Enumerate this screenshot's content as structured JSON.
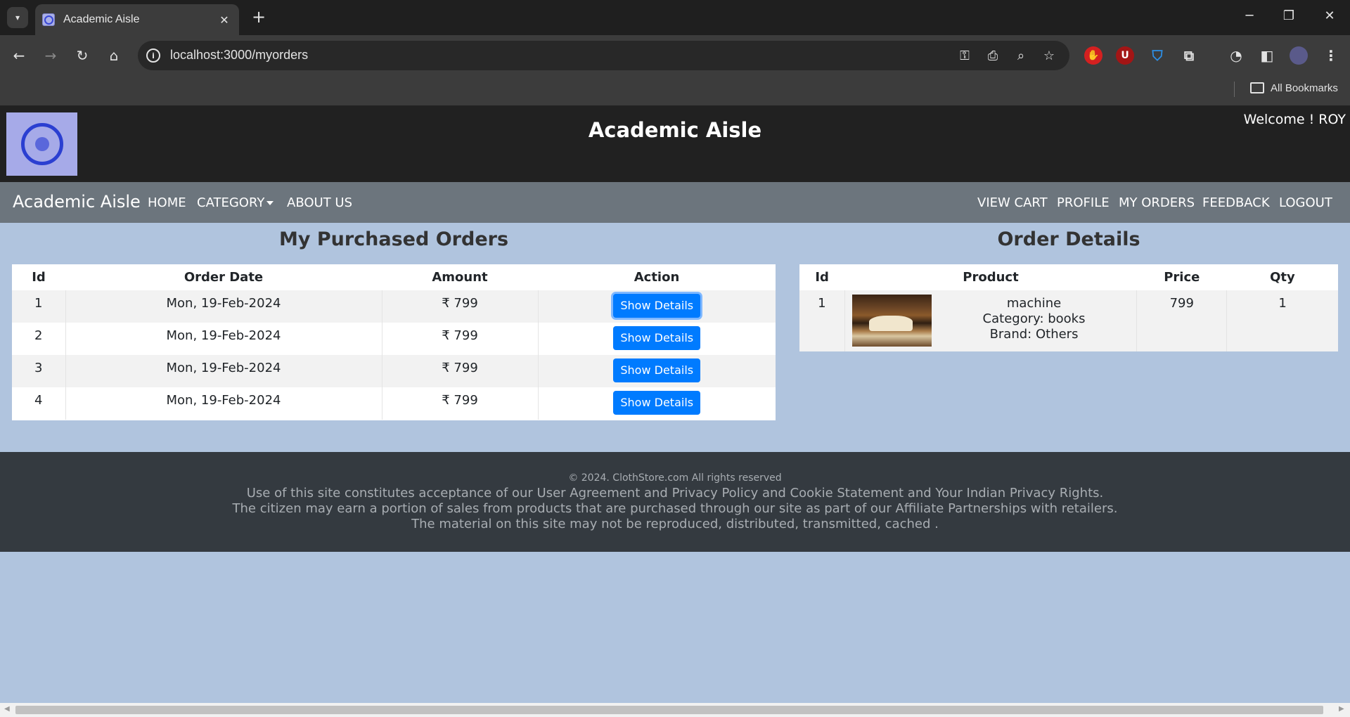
{
  "browser": {
    "tab_title": "Academic Aisle",
    "url": "localhost:3000/myorders",
    "all_bookmarks": "All Bookmarks",
    "icons": [
      "tab-search-icon",
      "close-icon",
      "new-tab-icon",
      "back-icon",
      "forward-icon",
      "reload-icon",
      "home-icon",
      "site-info-icon",
      "password-key-icon",
      "install-app-icon",
      "zoom-icon",
      "bookmark-star-icon",
      "adblock-icon",
      "ublock-icon",
      "shield-icon",
      "extensions-icon",
      "performance-icon",
      "side-panel-icon",
      "profile-avatar",
      "menu-icon",
      "minimize-icon",
      "restore-icon",
      "window-close-icon",
      "folder-icon"
    ]
  },
  "header": {
    "title": "Academic Aisle",
    "welcome": "Welcome ! ROY"
  },
  "navbar": {
    "brand": "Academic Aisle",
    "left_links": [
      "HOME",
      "CATEGORY",
      "ABOUT US"
    ],
    "right_links": [
      "VIEW CART",
      "PROFILE",
      "MY ORDERS",
      "FEEDBACK",
      "LOGOUT"
    ]
  },
  "orders": {
    "title": "My Purchased Orders",
    "headers": [
      "Id",
      "Order Date",
      "Amount",
      "Action"
    ],
    "rows": [
      {
        "id": "1",
        "date": "Mon, 19-Feb-2024",
        "amount": "₹ 799",
        "action": "Show Details"
      },
      {
        "id": "2",
        "date": "Mon, 19-Feb-2024",
        "amount": "₹ 799",
        "action": "Show Details"
      },
      {
        "id": "3",
        "date": "Mon, 19-Feb-2024",
        "amount": "₹ 799",
        "action": "Show Details"
      },
      {
        "id": "4",
        "date": "Mon, 19-Feb-2024",
        "amount": "₹ 799",
        "action": "Show Details"
      }
    ]
  },
  "details": {
    "title": "Order Details",
    "headers": [
      "Id",
      "Product",
      "Price",
      "Qty"
    ],
    "rows": [
      {
        "id": "1",
        "name": "machine",
        "category": "Category: books",
        "brand": "Brand: Others",
        "price": "799",
        "qty": "1"
      }
    ]
  },
  "footer": {
    "copyright": "© 2024. ClothStore.com All rights reserved",
    "line1": "Use of this site constitutes acceptance of our User Agreement and Privacy Policy and Cookie Statement and Your Indian Privacy Rights.",
    "line2": "The citizen may earn a portion of sales from products that are purchased through our site as part of our Affiliate Partnerships with retailers.",
    "line3": "The material on this site may not be reproduced, distributed, transmitted, cached ."
  },
  "colors": {
    "page_bg": "#b0c4de",
    "header_bg": "#212121",
    "navbar_bg": "#6c757d",
    "footer_bg": "#343a40",
    "button_bg": "#007bff"
  }
}
